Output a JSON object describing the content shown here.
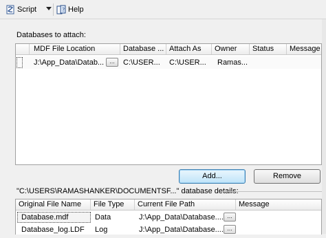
{
  "toolbar": {
    "script_label": "Script",
    "help_label": "Help"
  },
  "attach": {
    "label": "Databases to attach:",
    "columns": [
      "MDF File Location",
      "Database ...",
      "Attach As",
      "Owner",
      "Status",
      "Message"
    ],
    "rows": [
      {
        "location": "J:\\App_Data\\Datab...",
        "database": "C:\\USER...",
        "attach_as": "C:\\USER...",
        "owner": "Ramas...",
        "status": "",
        "message": ""
      }
    ],
    "browse_glyph": "...",
    "add_button": "Add...",
    "remove_button": "Remove"
  },
  "details": {
    "label": "\"C:\\USERS\\RAMASHANKER\\DOCUMENTSF...\" database details:",
    "columns": [
      "Original File Name",
      "File Type",
      "Current File Path",
      "Message"
    ],
    "rows": [
      {
        "name": "Database.mdf",
        "type": "Data",
        "path": "J:\\App_Data\\Database....",
        "message": ""
      },
      {
        "name": "Database_log.LDF",
        "type": "Log",
        "path": "J:\\App_Data\\Database....",
        "message": ""
      }
    ],
    "browse_glyph": "..."
  }
}
